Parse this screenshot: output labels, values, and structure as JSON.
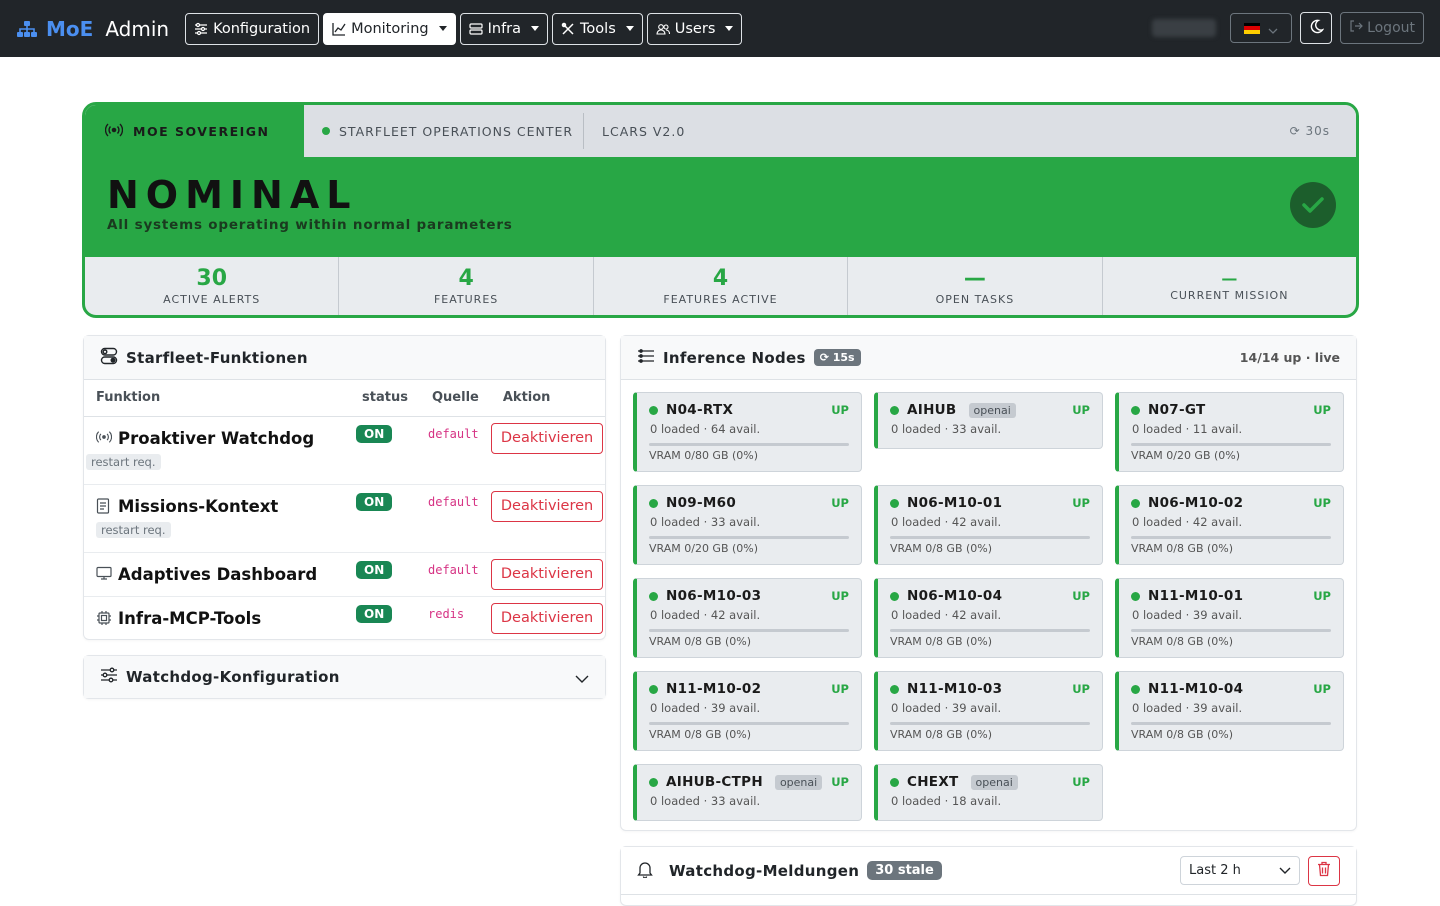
{
  "nav": {
    "brand_moe": "MoE",
    "brand_admin": "Admin",
    "items": [
      {
        "label": "Konfiguration",
        "icon": "sliders-icon"
      },
      {
        "label": "Monitoring",
        "icon": "chart-icon"
      },
      {
        "label": "Infra",
        "icon": "server-icon"
      },
      {
        "label": "Tools",
        "icon": "tools-icon"
      },
      {
        "label": "Users",
        "icon": "users-icon"
      }
    ],
    "logout": "Logout"
  },
  "status": {
    "brand": "MOE SOVEREIGN",
    "center": "STARFLEET OPERATIONS CENTER",
    "version": "LCARS V2.0",
    "refresh": "⟳ 30s",
    "state": "NOMINAL",
    "state_sub": "All systems operating within normal parameters",
    "stats": [
      {
        "value": "30",
        "label": "ACTIVE ALERTS"
      },
      {
        "value": "4",
        "label": "FEATURES"
      },
      {
        "value": "4",
        "label": "FEATURES ACTIVE"
      },
      {
        "value": "—",
        "label": "OPEN TASKS"
      },
      {
        "value": "—",
        "label": "CURRENT MISSION"
      }
    ]
  },
  "features": {
    "title": "Starfleet-Funktionen",
    "headers": [
      "Funktion",
      "status",
      "Quelle",
      "Aktion"
    ],
    "rows": [
      {
        "name": "Proaktiver Watchdog",
        "req": "restart req.",
        "status": "ON",
        "source": "default",
        "action": "Deaktivieren"
      },
      {
        "name": "Missions-Kontext",
        "req": "restart req.",
        "status": "ON",
        "source": "default",
        "action": "Deaktivieren"
      },
      {
        "name": "Adaptives Dashboard",
        "req": "",
        "status": "ON",
        "source": "default",
        "action": "Deaktivieren"
      },
      {
        "name": "Infra-MCP-Tools",
        "req": "",
        "status": "ON",
        "source": "redis",
        "action": "Deaktivieren"
      }
    ]
  },
  "watchdog_config": {
    "title": "Watchdog-Konfiguration"
  },
  "nodes": {
    "title": "Inference Nodes",
    "refresh": "⟳ 15s",
    "summary": "14/14 up · live",
    "items": [
      {
        "name": "N04-RTX",
        "provider": "",
        "status": "UP",
        "load": "0 loaded · 64 avail.",
        "vram": "VRAM 0/80 GB (0%)",
        "vram_pct": 0
      },
      {
        "name": "AIHUB",
        "provider": "openai",
        "status": "UP",
        "load": "0 loaded · 33 avail.",
        "vram": "",
        "vram_pct": 0
      },
      {
        "name": "N07-GT",
        "provider": "",
        "status": "UP",
        "load": "0 loaded · 11 avail.",
        "vram": "VRAM 0/20 GB (0%)",
        "vram_pct": 0
      },
      {
        "name": "N09-M60",
        "provider": "",
        "status": "UP",
        "load": "0 loaded · 33 avail.",
        "vram": "VRAM 0/20 GB (0%)",
        "vram_pct": 0
      },
      {
        "name": "N06-M10-01",
        "provider": "",
        "status": "UP",
        "load": "0 loaded · 42 avail.",
        "vram": "VRAM 0/8 GB (0%)",
        "vram_pct": 0
      },
      {
        "name": "N06-M10-02",
        "provider": "",
        "status": "UP",
        "load": "0 loaded · 42 avail.",
        "vram": "VRAM 0/8 GB (0%)",
        "vram_pct": 0
      },
      {
        "name": "N06-M10-03",
        "provider": "",
        "status": "UP",
        "load": "0 loaded · 42 avail.",
        "vram": "VRAM 0/8 GB (0%)",
        "vram_pct": 0
      },
      {
        "name": "N06-M10-04",
        "provider": "",
        "status": "UP",
        "load": "0 loaded · 42 avail.",
        "vram": "VRAM 0/8 GB (0%)",
        "vram_pct": 0
      },
      {
        "name": "N11-M10-01",
        "provider": "",
        "status": "UP",
        "load": "0 loaded · 39 avail.",
        "vram": "VRAM 0/8 GB (0%)",
        "vram_pct": 0
      },
      {
        "name": "N11-M10-02",
        "provider": "",
        "status": "UP",
        "load": "0 loaded · 39 avail.",
        "vram": "VRAM 0/8 GB (0%)",
        "vram_pct": 0
      },
      {
        "name": "N11-M10-03",
        "provider": "",
        "status": "UP",
        "load": "0 loaded · 39 avail.",
        "vram": "VRAM 0/8 GB (0%)",
        "vram_pct": 0
      },
      {
        "name": "N11-M10-04",
        "provider": "",
        "status": "UP",
        "load": "0 loaded · 39 avail.",
        "vram": "VRAM 0/8 GB (0%)",
        "vram_pct": 0
      },
      {
        "name": "AIHUB-CTPH",
        "provider": "openai",
        "status": "UP",
        "load": "0 loaded · 33 avail.",
        "vram": "",
        "vram_pct": 0
      },
      {
        "name": "CHEXT",
        "provider": "openai",
        "status": "UP",
        "load": "0 loaded · 18 avail.",
        "vram": "",
        "vram_pct": 0
      }
    ]
  },
  "messages": {
    "title": "Watchdog-Meldungen",
    "badge": "30 stale",
    "range": "Last 2 h"
  },
  "colors": {
    "accent": "#28a745",
    "navbar": "#212529",
    "danger": "#dc3545"
  }
}
